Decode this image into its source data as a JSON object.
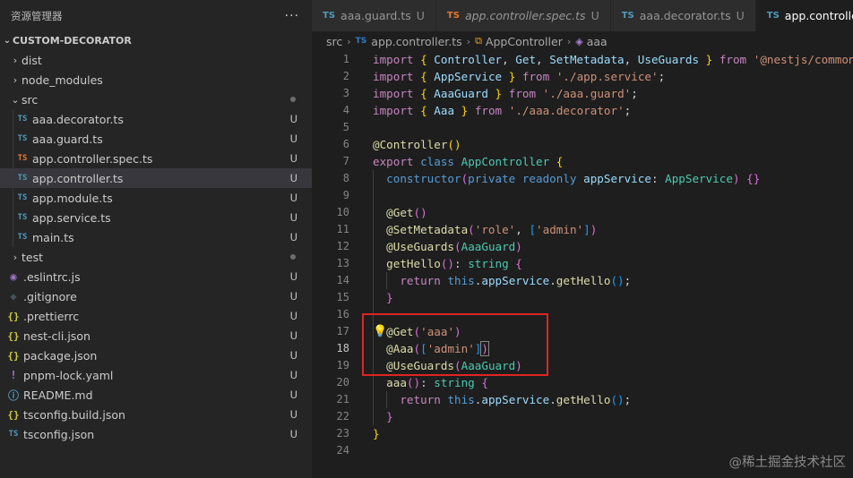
{
  "sidebar": {
    "title": "资源管理器",
    "more": "···",
    "project": "CUSTOM-DECORATOR",
    "items": [
      {
        "name": "dist",
        "type": "folder",
        "icon": "chevron-right-icon"
      },
      {
        "name": "node_modules",
        "type": "folder",
        "icon": "chevron-right-icon"
      },
      {
        "name": "src",
        "type": "folder-open",
        "icon": "chevron-down-icon",
        "dot": true
      },
      {
        "name": "aaa.decorator.ts",
        "type": "ts",
        "badge": "U",
        "indent": 1
      },
      {
        "name": "aaa.guard.ts",
        "type": "ts",
        "badge": "U",
        "indent": 1
      },
      {
        "name": "app.controller.spec.ts",
        "type": "ts-spec",
        "badge": "U",
        "indent": 1
      },
      {
        "name": "app.controller.ts",
        "type": "ts",
        "badge": "U",
        "indent": 1,
        "selected": true
      },
      {
        "name": "app.module.ts",
        "type": "ts",
        "badge": "U",
        "indent": 1
      },
      {
        "name": "app.service.ts",
        "type": "ts",
        "badge": "U",
        "indent": 1
      },
      {
        "name": "main.ts",
        "type": "ts",
        "badge": "U",
        "indent": 1
      },
      {
        "name": "test",
        "type": "folder",
        "icon": "chevron-right-icon",
        "dot": true
      },
      {
        "name": ".eslintrc.js",
        "type": "eslint",
        "badge": "U"
      },
      {
        "name": ".gitignore",
        "type": "git",
        "badge": "U"
      },
      {
        "name": ".prettierrc",
        "type": "json",
        "badge": "U"
      },
      {
        "name": "nest-cli.json",
        "type": "json",
        "badge": "U"
      },
      {
        "name": "package.json",
        "type": "json",
        "badge": "U"
      },
      {
        "name": "pnpm-lock.yaml",
        "type": "yaml",
        "badge": "U"
      },
      {
        "name": "README.md",
        "type": "info",
        "badge": "U"
      },
      {
        "name": "tsconfig.build.json",
        "type": "json",
        "badge": "U"
      },
      {
        "name": "tsconfig.json",
        "type": "tsconfig",
        "badge": "U"
      }
    ]
  },
  "tabs": [
    {
      "label": "aaa.guard.ts",
      "prefix": "TS",
      "status": "U",
      "prefix_color": "#519aba"
    },
    {
      "label": "app.controller.spec.ts",
      "prefix": "TS",
      "status": "U",
      "prefix_color": "#e37933",
      "italic": true
    },
    {
      "label": "aaa.decorator.ts",
      "prefix": "TS",
      "status": "U",
      "prefix_color": "#519aba"
    },
    {
      "label": "app.controller.ts",
      "prefix": "TS",
      "status": "",
      "prefix_color": "#519aba",
      "active": true
    }
  ],
  "breadcrumb": {
    "folder": "src",
    "file_prefix": "TS",
    "file": "app.controller.ts",
    "class": "AppController",
    "member": "aaa"
  },
  "editor": {
    "current_line": 18,
    "line_numbers": [
      "1",
      "2",
      "3",
      "4",
      "5",
      "6",
      "7",
      "8",
      "9",
      "10",
      "11",
      "12",
      "13",
      "14",
      "15",
      "16",
      "17",
      "18",
      "19",
      "20",
      "21",
      "22",
      "23",
      "24"
    ]
  },
  "watermark": "@稀土掘金技术社区",
  "colors": {
    "highlight_box": "#e02424",
    "ts_blue": "#519aba",
    "ts_orange": "#e37933"
  }
}
